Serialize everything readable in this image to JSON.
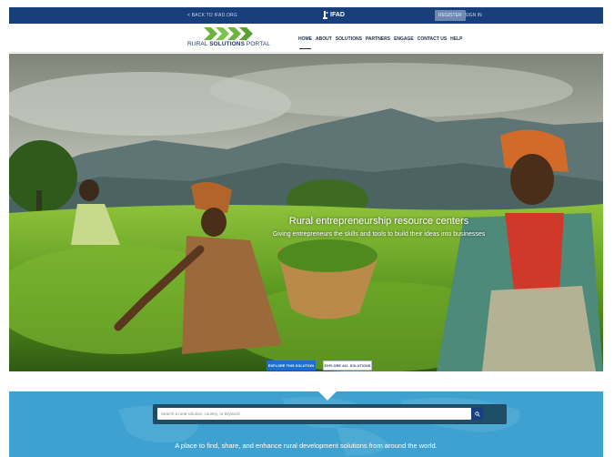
{
  "topbar": {
    "back_link": "< BACK TO IFAD.ORG",
    "brand": "IFAD",
    "register_label": "REGISTER",
    "signin_label": "SIGN IN"
  },
  "logo": {
    "text_regular_1": "RURAL ",
    "text_bold": "SOLUTIONS",
    "text_regular_2": " PORTAL"
  },
  "nav": {
    "items": [
      "HOME",
      "ABOUT",
      "SOLUTIONS",
      "PARTNERS",
      "ENGAGE",
      "CONTACT US",
      "HELP"
    ],
    "active": "HOME"
  },
  "hero": {
    "title": "Rural entrepreneurship resource centers",
    "subtitle": "Giving entrepreneurs the skills and tools to build their ideas into businesses",
    "explore_button": "EXPLORE THIS SOLUTION",
    "explore_all_button": "EXPLORE ALL SOLUTIONS"
  },
  "search": {
    "placeholder": "Search a rural solution, country, or keyword"
  },
  "band": {
    "tagline": "A place to find, share, and enhance rural development solutions from around the world."
  },
  "colors": {
    "topbar": "#183f7a",
    "band": "#3ea1cf",
    "primary_button": "#1b6fd0",
    "logo_green": "#6cb33f"
  }
}
